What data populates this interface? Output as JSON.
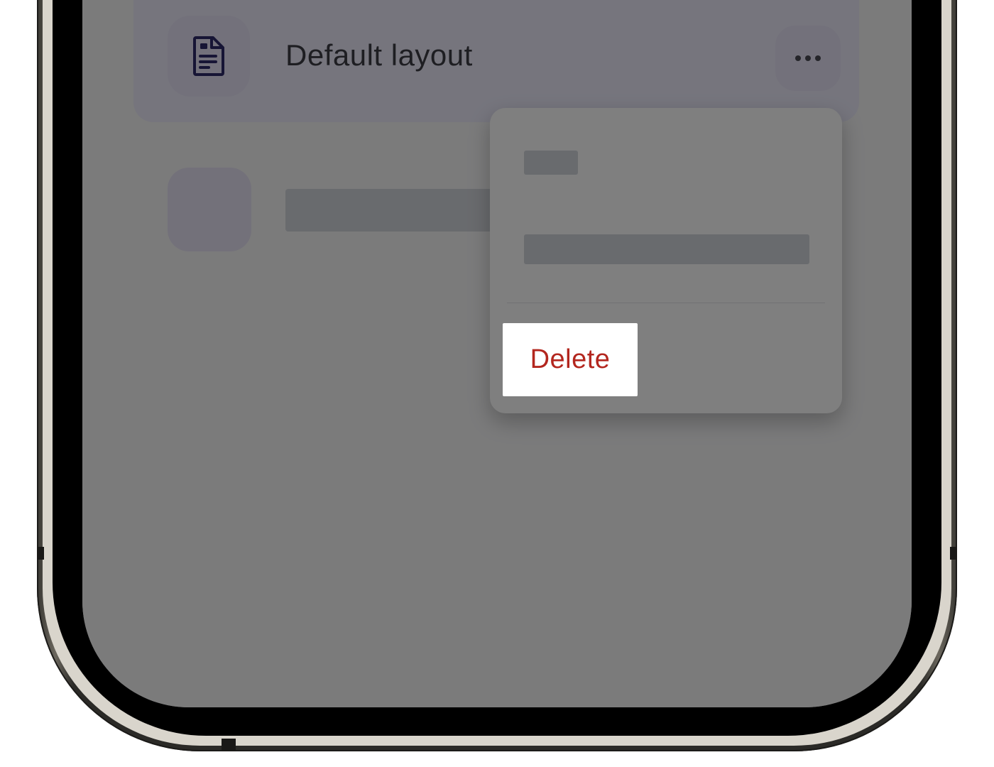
{
  "list": {
    "selected_row": {
      "title": "Default layout",
      "icon": "document-icon",
      "more_icon": "ellipsis-icon"
    },
    "second_row": {
      "icon": "placeholder-icon"
    }
  },
  "context_menu": {
    "delete_label": "Delete"
  },
  "colors": {
    "delete": "#b3261e",
    "overlay": "rgba(0,0,0,0.5)",
    "accent_surface": "#ecebfb"
  }
}
